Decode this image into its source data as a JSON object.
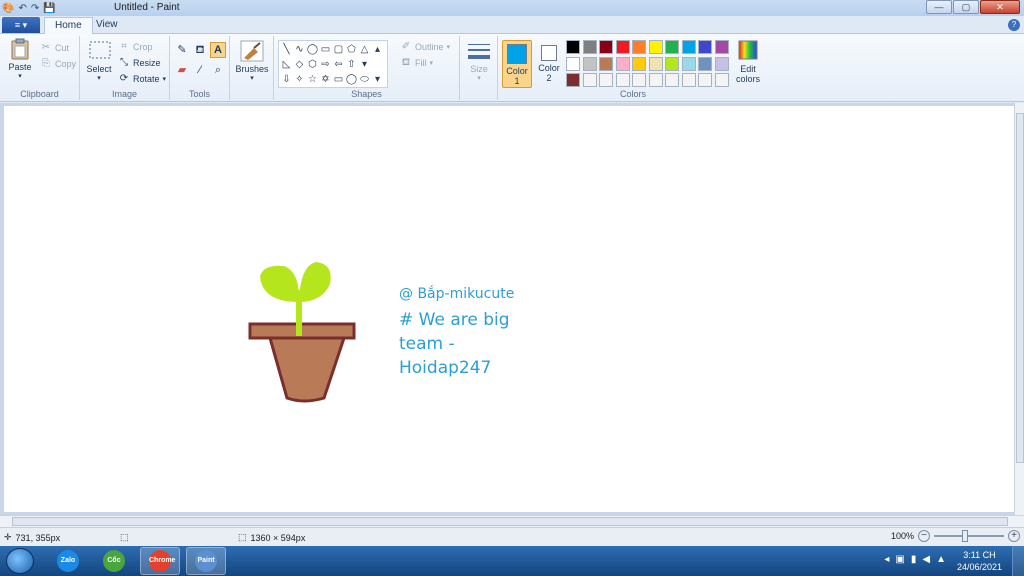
{
  "window": {
    "title": "Untitled - Paint",
    "buttons": {
      "minimize": "—",
      "maximize": "▢",
      "close": "✕"
    }
  },
  "quick_access": {
    "menu_icon": "menu-icon",
    "undo": "↶",
    "redo": "↷",
    "save": "💾"
  },
  "tabs": {
    "file": "≡ ▾",
    "home": "Home",
    "view": "View",
    "help": "?"
  },
  "ribbon": {
    "clipboard": {
      "label": "Clipboard",
      "paste": "Paste",
      "cut": "Cut",
      "copy": "Copy"
    },
    "image": {
      "label": "Image",
      "select": "Select",
      "crop": "Crop",
      "resize": "Resize",
      "rotate": "Rotate"
    },
    "tools": {
      "label": "Tools"
    },
    "brushes": {
      "label": "Brushes"
    },
    "shapes": {
      "label": "Shapes",
      "outline": "Outline",
      "fill": "Fill",
      "glyphs": [
        "╲",
        "∿",
        "◯",
        "▭",
        "▢",
        "⬠",
        "△",
        "▴",
        "◺",
        "◇",
        "⬡",
        "⇨",
        "⇦",
        "⇧",
        "▾",
        "",
        "⇩",
        "✧",
        "☆",
        "✡",
        "▭",
        "◯",
        "⬭",
        "▾"
      ]
    },
    "size": {
      "label": "Size"
    },
    "colors": {
      "label": "Colors",
      "color1": "Color",
      "color1_num": "1",
      "color2": "Color",
      "color2_num": "2",
      "edit": "Edit",
      "edit2": "colors",
      "color1_value": "#00a2e8",
      "color2_value": "#ffffff",
      "palette": [
        "#000000",
        "#7f7f7f",
        "#880015",
        "#ed1c24",
        "#ff7f27",
        "#fff200",
        "#22b14c",
        "#00a2e8",
        "#3f48cc",
        "#a349a4",
        "#ffffff",
        "#c3c3c3",
        "#b97a57",
        "#ffaec9",
        "#ffc90e",
        "#efe4b0",
        "#b5e61d",
        "#99d9ea",
        "#7092be",
        "#c8bfe7",
        "#7b2e2e",
        "#f4f4f4",
        "#f4f4f4",
        "#f4f4f4",
        "#f4f4f4",
        "#f4f4f4",
        "#f4f4f4",
        "#f4f4f4",
        "#f4f4f4",
        "#f4f4f4"
      ]
    }
  },
  "canvas_text": {
    "line1": "@ Bắp-mikucute",
    "line2": "# We are big",
    "line3": "team -",
    "line4": "Hoidap247"
  },
  "status": {
    "cursor_pos": "731, 355px",
    "selection": "",
    "image_size": "1360 × 594px",
    "zoom": "100%"
  },
  "taskbar": {
    "apps": [
      {
        "name": "Zalo",
        "color": "#1a8ae6"
      },
      {
        "name": "Cốc Cốc",
        "color": "#4aa53c"
      },
      {
        "name": "Chrome",
        "color": "#e4412d"
      },
      {
        "name": "Paint",
        "color": "#5b8fd0"
      }
    ],
    "time": "3:11 CH",
    "date": "24/06/2021"
  }
}
